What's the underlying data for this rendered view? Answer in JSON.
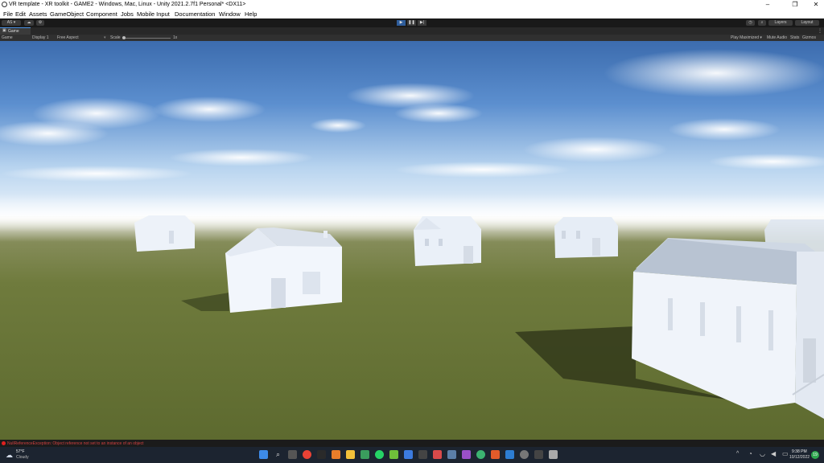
{
  "window": {
    "title": "VR template - XR toolkit - GAME2 - Windows, Mac, Linux - Unity 2021.2.7f1 Personal* <DX11>",
    "minimize": "–",
    "maximize": "❐",
    "close": "✕"
  },
  "menu": [
    "File",
    "Edit",
    "Assets",
    "GameObject",
    "Component",
    "Jobs",
    "Mobile Input",
    "Documentation",
    "Window",
    "Help"
  ],
  "toolbar": {
    "account": "AS ▾",
    "play": "▶",
    "pause": "❚❚",
    "step": "▶|",
    "layers": "Layers",
    "layout": "Layout"
  },
  "tab": {
    "label": "Game"
  },
  "gamebar": {
    "mode": "Game",
    "display": "Display 1",
    "aspect": "Free Aspect",
    "scale_label": "Scale",
    "scale_value": "1x",
    "play_maximized": "Play Maximized ▾",
    "mute_audio": "Mute Audio",
    "stats": "Stats",
    "gizmos": "Gizmos"
  },
  "status": {
    "message": "NullReferenceException: Object reference not set to an instance of an object",
    "error_color": "#e02020"
  },
  "weather": {
    "temp": "57°F",
    "condition": "Cloudy"
  },
  "clock": {
    "time": "9:38 PM",
    "date": "10/12/2022"
  },
  "notification_count": "19",
  "colors": {
    "sky_top": "#3f6fb0",
    "sky_horizon": "#e8f2fb",
    "grass": "#6d7a3a",
    "house": "#eef3fb"
  }
}
